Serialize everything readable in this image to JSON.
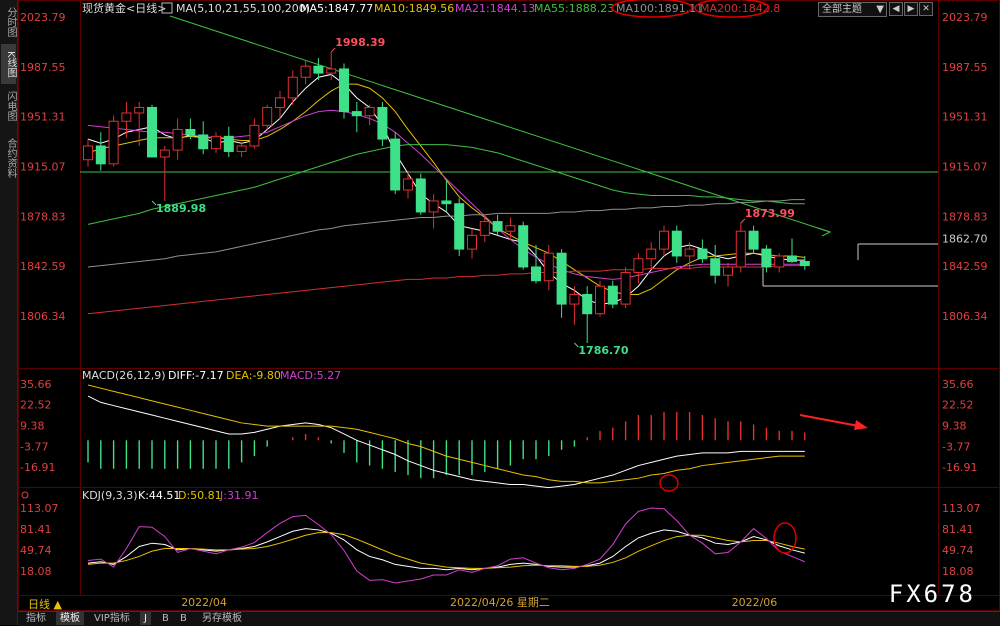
{
  "left_tabs": [
    {
      "label": "分时图",
      "active": false
    },
    {
      "label": "K线图",
      "active": true
    },
    {
      "label": "闪电图",
      "active": false
    },
    {
      "label": "合约资料",
      "active": false
    }
  ],
  "header": {
    "symbol": "现货黄金<日线>",
    "ma_params": "MA(5,10,21,55,100,200)",
    "ma5": "MA5:1847.77",
    "ma10": "MA10:1849.56",
    "ma21": "MA21:1844.13",
    "ma55": "MA55:1888.23",
    "ma100": "MA100:1891.11",
    "ma200": "MA200:1842.8",
    "theme_select": "全部主题",
    "theme_arrow": "▼",
    "btn_prev": "◀",
    "btn_next": "▶",
    "btn_close": "✕"
  },
  "macd_header": {
    "params": "MACD(26,12,9)",
    "diff": "DIFF:-7.17",
    "dea": "DEA:-9.80",
    "macd": "MACD:5.27"
  },
  "kdj_header": {
    "params": "KDJ(9,3,3)",
    "k": "K:44.51",
    "d": "D:50.81",
    "j": "J:31.91"
  },
  "bottom_tabs": [
    {
      "label": "指标",
      "active": false
    },
    {
      "label": "模板",
      "active": true
    },
    {
      "label": "VIP指标",
      "active": false
    },
    {
      "label": "J",
      "active": true
    },
    {
      "label": "B",
      "active": false
    },
    {
      "label": "B",
      "active": false
    },
    {
      "label": "另存模板",
      "active": false
    }
  ],
  "period_label": "日线 ▲",
  "watermark": "FX678",
  "colors": {
    "up": "#e03030",
    "down": "#3ee08a",
    "ma5": "#ffffff",
    "ma10": "#e6c200",
    "ma21": "#d040d0",
    "ma55": "#40c040",
    "ma100": "#909090",
    "ma200": "#d03030",
    "axis_text": "#d33",
    "circle": "#e00000"
  },
  "chart_data": {
    "type": "candlestick",
    "price_ticks": [
      2023.79,
      1987.55,
      1951.31,
      1915.07,
      1878.83,
      1842.59,
      1806.34
    ],
    "price_range": [
      1770,
      2030
    ],
    "x_labels": [
      {
        "label": "2022/04",
        "index": 9
      },
      {
        "label": "2022/04/26 星期二",
        "index": 30
      },
      {
        "label": "2022/06",
        "index": 52
      }
    ],
    "annotations": [
      {
        "text": "1998.39",
        "index": 19,
        "price": 1998.39,
        "color": "#ff5060"
      },
      {
        "text": "1889.98",
        "index": 5,
        "price": 1889.98,
        "color": "#3ee08a"
      },
      {
        "text": "1786.70",
        "index": 38,
        "price": 1786.7,
        "color": "#3ee08a"
      },
      {
        "text": "1873.99",
        "index": 51,
        "price": 1873.99,
        "color": "#ff5060"
      },
      {
        "text": "1862.70",
        "index": 55,
        "price": 1862.7,
        "color": "#cccccc"
      }
    ],
    "candles": [
      [
        1920,
        1935,
        1915,
        1930
      ],
      [
        1930,
        1940,
        1912,
        1917
      ],
      [
        1917,
        1952,
        1915,
        1948
      ],
      [
        1948,
        1962,
        1936,
        1954
      ],
      [
        1954,
        1962,
        1930,
        1958
      ],
      [
        1958,
        1960,
        1922,
        1922
      ],
      [
        1922,
        1930,
        1889.98,
        1927
      ],
      [
        1927,
        1950,
        1920,
        1942
      ],
      [
        1942,
        1950,
        1935,
        1938
      ],
      [
        1938,
        1948,
        1924,
        1928
      ],
      [
        1928,
        1940,
        1925,
        1937
      ],
      [
        1937,
        1944,
        1922,
        1926
      ],
      [
        1926,
        1932,
        1922,
        1930
      ],
      [
        1930,
        1950,
        1928,
        1945
      ],
      [
        1945,
        1960,
        1942,
        1958
      ],
      [
        1958,
        1970,
        1950,
        1965
      ],
      [
        1965,
        1985,
        1960,
        1980
      ],
      [
        1980,
        1992,
        1975,
        1988
      ],
      [
        1988,
        1994,
        1978,
        1983
      ],
      [
        1983,
        1998.39,
        1978,
        1986
      ],
      [
        1986,
        1990,
        1950,
        1955
      ],
      [
        1955,
        1962,
        1940,
        1952
      ],
      [
        1952,
        1960,
        1945,
        1958
      ],
      [
        1958,
        1962,
        1930,
        1935
      ],
      [
        1935,
        1940,
        1895,
        1898
      ],
      [
        1898,
        1912,
        1892,
        1906
      ],
      [
        1906,
        1910,
        1880,
        1882
      ],
      [
        1882,
        1895,
        1870,
        1890
      ],
      [
        1890,
        1905,
        1882,
        1888
      ],
      [
        1888,
        1892,
        1850,
        1855
      ],
      [
        1855,
        1870,
        1848,
        1865
      ],
      [
        1865,
        1880,
        1860,
        1875
      ],
      [
        1875,
        1880,
        1865,
        1868
      ],
      [
        1868,
        1878,
        1862,
        1872
      ],
      [
        1872,
        1875,
        1840,
        1842
      ],
      [
        1842,
        1858,
        1830,
        1832
      ],
      [
        1832,
        1858,
        1825,
        1852
      ],
      [
        1852,
        1855,
        1805,
        1815
      ],
      [
        1815,
        1828,
        1800,
        1822
      ],
      [
        1822,
        1828,
        1786.7,
        1808
      ],
      [
        1808,
        1832,
        1806,
        1828
      ],
      [
        1828,
        1832,
        1812,
        1815
      ],
      [
        1815,
        1842,
        1812,
        1838
      ],
      [
        1838,
        1852,
        1830,
        1848
      ],
      [
        1848,
        1860,
        1840,
        1855
      ],
      [
        1855,
        1872,
        1850,
        1868
      ],
      [
        1868,
        1872,
        1845,
        1850
      ],
      [
        1850,
        1860,
        1840,
        1855
      ],
      [
        1855,
        1862,
        1845,
        1848
      ],
      [
        1848,
        1858,
        1830,
        1836
      ],
      [
        1836,
        1845,
        1828,
        1842
      ],
      [
        1842,
        1873.99,
        1838,
        1868
      ],
      [
        1868,
        1872,
        1852,
        1855
      ],
      [
        1855,
        1858,
        1838,
        1842
      ],
      [
        1842,
        1852,
        1838,
        1850
      ],
      [
        1850,
        1862.7,
        1845,
        1846
      ],
      [
        1846,
        1850,
        1840,
        1843
      ]
    ],
    "ma_series": {
      "MA5": [
        1935,
        1932,
        1935,
        1940,
        1942,
        1944,
        1938,
        1935,
        1938,
        1936,
        1932,
        1934,
        1932,
        1934,
        1942,
        1950,
        1962,
        1972,
        1980,
        1982,
        1975,
        1965,
        1958,
        1945,
        1925,
        1910,
        1895,
        1888,
        1882,
        1872,
        1870,
        1868,
        1865,
        1862,
        1860,
        1850,
        1838,
        1830,
        1825,
        1818,
        1815,
        1816,
        1820,
        1828,
        1840,
        1850,
        1856,
        1858,
        1855,
        1850,
        1848,
        1850,
        1852,
        1850,
        1848,
        1847,
        1847
      ],
      "MA10": [
        1925,
        1928,
        1930,
        1932,
        1934,
        1936,
        1936,
        1936,
        1937,
        1936,
        1936,
        1935,
        1934,
        1934,
        1937,
        1942,
        1948,
        1955,
        1963,
        1970,
        1975,
        1975,
        1972,
        1965,
        1955,
        1942,
        1930,
        1918,
        1905,
        1893,
        1885,
        1878,
        1870,
        1865,
        1860,
        1856,
        1852,
        1846,
        1840,
        1834,
        1828,
        1824,
        1822,
        1822,
        1826,
        1833,
        1840,
        1845,
        1849,
        1850,
        1851,
        1852,
        1852,
        1851,
        1850,
        1850,
        1849
      ],
      "MA21": [
        1945,
        1944,
        1943,
        1942,
        1941,
        1940,
        1940,
        1939,
        1938,
        1937,
        1936,
        1936,
        1937,
        1938,
        1940,
        1944,
        1948,
        1952,
        1955,
        1956,
        1955,
        1953,
        1950,
        1946,
        1940,
        1932,
        1924,
        1915,
        1906,
        1897,
        1888,
        1879,
        1870,
        1862,
        1855,
        1849,
        1844,
        1840,
        1837,
        1835,
        1834,
        1833,
        1834,
        1836,
        1838,
        1840,
        1842,
        1843,
        1844,
        1844,
        1844,
        1844,
        1844,
        1844,
        1844,
        1844,
        1844
      ],
      "MA55": [
        1873,
        1875,
        1877,
        1879,
        1881,
        1884,
        1886,
        1888,
        1890,
        1892,
        1894,
        1896,
        1898,
        1900,
        1903,
        1906,
        1909,
        1912,
        1915,
        1918,
        1921,
        1924,
        1926,
        1928,
        1930,
        1931,
        1931,
        1931,
        1931,
        1930,
        1929,
        1927,
        1925,
        1922,
        1919,
        1916,
        1913,
        1910,
        1907,
        1904,
        1901,
        1898,
        1896,
        1895,
        1894,
        1894,
        1894,
        1894,
        1893,
        1893,
        1892,
        1891,
        1890,
        1890,
        1889,
        1888,
        1888
      ],
      "MA100": [
        1842,
        1843,
        1844,
        1845,
        1846,
        1847,
        1848,
        1850,
        1851,
        1852,
        1853,
        1855,
        1857,
        1859,
        1861,
        1863,
        1865,
        1867,
        1869,
        1870,
        1872,
        1873,
        1874,
        1875,
        1876,
        1877,
        1878,
        1878,
        1879,
        1879,
        1880,
        1880,
        1881,
        1881,
        1881,
        1881,
        1881,
        1882,
        1882,
        1883,
        1883,
        1884,
        1884,
        1885,
        1885,
        1886,
        1886,
        1887,
        1887,
        1888,
        1888,
        1889,
        1889,
        1890,
        1890,
        1891,
        1891
      ],
      "MA200": [
        1808,
        1809,
        1810,
        1811,
        1812,
        1813,
        1814,
        1815,
        1816,
        1817,
        1818,
        1819,
        1820,
        1821,
        1822,
        1823,
        1824,
        1825,
        1826,
        1827,
        1828,
        1829,
        1830,
        1831,
        1832,
        1833,
        1833,
        1834,
        1834,
        1835,
        1835,
        1836,
        1836,
        1837,
        1837,
        1838,
        1838,
        1838,
        1839,
        1839,
        1839,
        1840,
        1840,
        1840,
        1841,
        1841,
        1841,
        1841,
        1842,
        1842,
        1842,
        1842,
        1842,
        1842,
        1843,
        1843,
        1843
      ]
    },
    "macd_ticks": [
      35.66,
      22.52,
      9.38,
      -3.77,
      -16.91
    ],
    "macd_range": [
      -30,
      40
    ],
    "diff": [
      28,
      24,
      22,
      20,
      18,
      16,
      14,
      12,
      10,
      8,
      6,
      4,
      4,
      5,
      7,
      9,
      10,
      11,
      10,
      8,
      4,
      0,
      -3,
      -6,
      -9,
      -13,
      -16,
      -19,
      -21,
      -23,
      -25,
      -26,
      -27,
      -28,
      -28,
      -29,
      -30,
      -29,
      -28,
      -26,
      -24,
      -22,
      -19,
      -16,
      -14,
      -12,
      -10,
      -9,
      -8,
      -8,
      -8,
      -7,
      -7,
      -7,
      -7,
      -7,
      -7
    ],
    "dea": [
      35,
      33,
      31,
      29,
      27,
      25,
      23,
      21,
      19,
      17,
      15,
      13,
      11,
      10,
      9,
      9,
      9,
      9,
      9,
      9,
      8,
      7,
      5,
      3,
      1,
      -2,
      -4,
      -7,
      -10,
      -12,
      -14,
      -16,
      -18,
      -20,
      -22,
      -23,
      -25,
      -26,
      -26,
      -27,
      -27,
      -26,
      -25,
      -24,
      -22,
      -21,
      -19,
      -18,
      -16,
      -15,
      -14,
      -13,
      -12,
      -11,
      -10,
      -10,
      -10
    ],
    "macd_hist": [
      -14,
      -18,
      -18,
      -18,
      -18,
      -18,
      -18,
      -18,
      -18,
      -18,
      -18,
      -18,
      -14,
      -10,
      -4,
      0,
      2,
      4,
      2,
      -2,
      -8,
      -14,
      -16,
      -18,
      -20,
      -22,
      -24,
      -24,
      -22,
      -22,
      -22,
      -20,
      -18,
      -16,
      -12,
      -12,
      -10,
      -6,
      -4,
      2,
      6,
      8,
      12,
      16,
      16,
      18,
      18,
      18,
      16,
      14,
      12,
      12,
      10,
      8,
      6,
      6,
      5
    ],
    "kdj_ticks": [
      113.07,
      81.41,
      49.74,
      18.08
    ],
    "kdj_range": [
      0,
      120
    ],
    "k": [
      30,
      32,
      28,
      40,
      55,
      60,
      58,
      50,
      52,
      50,
      48,
      50,
      52,
      55,
      62,
      70,
      78,
      82,
      80,
      75,
      65,
      50,
      40,
      35,
      28,
      25,
      22,
      22,
      20,
      22,
      20,
      22,
      24,
      28,
      30,
      28,
      25,
      24,
      24,
      26,
      30,
      40,
      55,
      68,
      75,
      80,
      78,
      72,
      68,
      60,
      58,
      62,
      70,
      65,
      56,
      50,
      45
    ],
    "d": [
      28,
      30,
      30,
      34,
      40,
      48,
      52,
      52,
      52,
      51,
      50,
      50,
      51,
      52,
      55,
      60,
      66,
      72,
      76,
      76,
      73,
      66,
      58,
      50,
      42,
      36,
      30,
      27,
      24,
      23,
      22,
      22,
      23,
      24,
      26,
      27,
      26,
      26,
      25,
      25,
      27,
      31,
      38,
      48,
      56,
      64,
      70,
      72,
      72,
      68,
      64,
      62,
      64,
      64,
      60,
      55,
      51
    ],
    "j": [
      34,
      36,
      24,
      52,
      85,
      84,
      70,
      46,
      52,
      48,
      44,
      50,
      54,
      61,
      76,
      90,
      100,
      102,
      88,
      73,
      49,
      18,
      4,
      5,
      0,
      3,
      6,
      12,
      12,
      20,
      16,
      22,
      26,
      36,
      38,
      30,
      23,
      20,
      22,
      28,
      36,
      58,
      89,
      108,
      113,
      112,
      94,
      72,
      60,
      44,
      46,
      62,
      82,
      67,
      48,
      40,
      32
    ]
  }
}
